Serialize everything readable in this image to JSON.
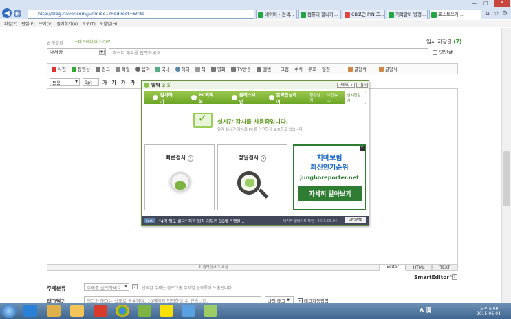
{
  "browser": {
    "url": "http://blog.naver.com/junmido1?Redirect=Write",
    "tabs": [
      {
        "label": "네이버 - 검색..."
      },
      {
        "label": "컴퓨터 웹니카..."
      },
      {
        "label": "CB코인 PIN 조..."
      },
      {
        "label": "개학알바 방정..."
      },
      {
        "label": "포스트쓰기 ..."
      }
    ],
    "menu": [
      "파일(F)",
      "편집(E)",
      "보기(V)",
      "즐겨찾기(A)",
      "도구(T)",
      "도움말(H)"
    ]
  },
  "editor": {
    "notice_label": "공개설정",
    "notice_option": "스마트에디터(2.0)로",
    "temp_save": "임시 저장글",
    "temp_save_count": "(7)",
    "category": "낙서장",
    "title_placeholder": "포스트 제목을 입력하세요",
    "english_label": "영인글",
    "toolbar": [
      "사진",
      "동영상",
      "링크",
      "파일",
      "음악",
      "국내",
      "해외",
      "책",
      "영화",
      "TV방송",
      "앨범",
      "그림",
      "수식",
      "투표",
      "일정",
      "글장식",
      "글양식"
    ],
    "font_family": "돋움",
    "font_size": "9pt",
    "format_buttons": [
      "가",
      "가",
      "가",
      "가"
    ],
    "resize_label": "입력창크기 조절",
    "modes": [
      "Editor",
      "HTML",
      "TEXT"
    ],
    "brand": "SmartEditor™",
    "subject_label": "주제분류",
    "subject_placeholder": "주제를 선택하세요",
    "subject_hint": "선택된 주제는 블로그홈 주제별 글목록에 노출됩니다.",
    "tag_label": "태그달기",
    "tag_placeholder": "태그와 태그는 쉼표로 구분하며, 10개까지 입력하실 수 있습니다.",
    "my_tags": "나의 태그",
    "auto_tag": "태그자동입력"
  },
  "alyac": {
    "title": "알약",
    "version": "2.5",
    "menu_btn": "MENU",
    "nav": [
      "검사하기",
      "PC최적화",
      "플러스보안",
      "알약안심케어"
    ],
    "nav_right": [
      "환경설정",
      "보안뉴스",
      "실시간감시"
    ],
    "status_title": "실시간 감시를 사용중입니다.",
    "status_sub": "알약 실시간 감시로 PC를 안전하게 보호하고 있습니다.",
    "quick_scan": "빠른검사",
    "deep_scan": "정밀검사",
    "ad": {
      "line1": "치아보험",
      "line2": "최신인기순위",
      "site": "jungboreporter.net",
      "button": "자세히 알아보기",
      "close": "x"
    },
    "news_tag": "뉴스",
    "news": "\"4억 줘도 싫다\" 하향 퇴직 거부한 56세 은행원...",
    "update_info": "마지막 업데이트 확인 : 2015.06.04",
    "update_btn": "UPDATE"
  },
  "taskbar": {
    "lang": "A 漢",
    "time": "오후 6:09",
    "date": "2015-06-04"
  }
}
